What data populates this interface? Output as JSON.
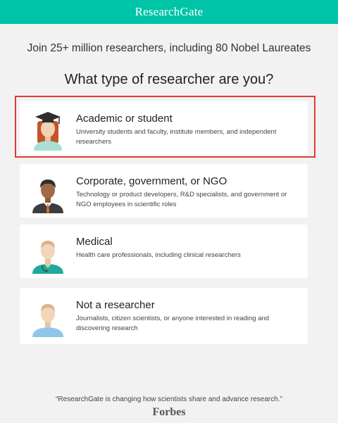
{
  "header": {
    "brand": "ResearchGate"
  },
  "tagline": "Join 25+ million researchers, including 80 Nobel Laureates",
  "question": "What type of researcher are you?",
  "options": [
    {
      "title": "Academic or student",
      "description": "University students and faculty, institute members, and independent researchers",
      "icon": "graduate-avatar-icon"
    },
    {
      "title": "Corporate, government, or NGO",
      "description": "Technology or product developers, R&D specialists, and government or NGO employees in scientific roles",
      "icon": "business-avatar-icon"
    },
    {
      "title": "Medical",
      "description": "Health care professionals, including clinical researchers",
      "icon": "doctor-avatar-icon"
    },
    {
      "title": "Not a researcher",
      "description": "Journalists, citizen scientists, or anyone interested in reading and discovering research",
      "icon": "person-avatar-icon"
    }
  ],
  "selected_option_index": 0,
  "footer": {
    "quote": "“ResearchGate is changing how scientists share and advance research.”",
    "source": "Forbes"
  },
  "colors": {
    "brand": "#00c4a8",
    "highlight": "#e03b35",
    "background": "#f2f2f2"
  }
}
